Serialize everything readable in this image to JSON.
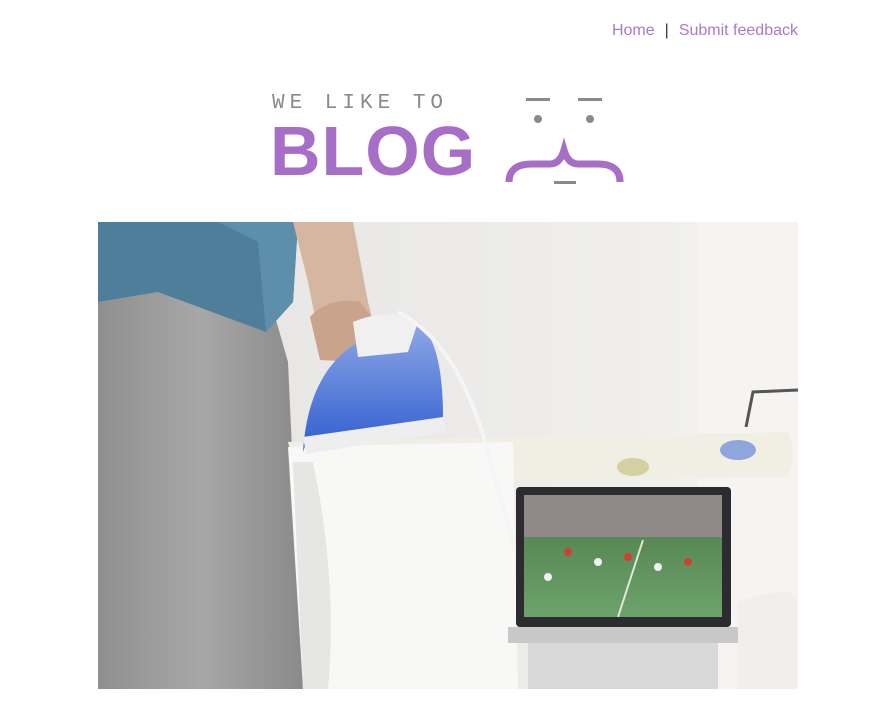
{
  "nav": {
    "home_label": "Home",
    "separator": "|",
    "feedback_label": "Submit feedback",
    "link_color": "#a97ac8"
  },
  "logo": {
    "tagline": "WE LIKE TO",
    "wordmark": "BLOG",
    "brand_color": "#a66ec6",
    "tagline_color": "#8a8a8a",
    "icon": "smiley-face-icon"
  },
  "hero": {
    "icon": "photo-ironing-with-tv-icon"
  }
}
